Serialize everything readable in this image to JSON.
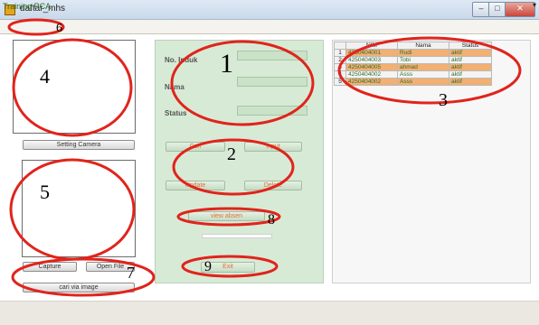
{
  "window": {
    "title": "daftar_mhs",
    "min_glyph": "–",
    "max_glyph": "□",
    "close_glyph": "✕"
  },
  "menu": {
    "training_label": "Training PCA",
    "arrow": "▾"
  },
  "left_panel": {
    "setting_camera_label": "Setting Camera",
    "capture_label": "Capture",
    "open_file_label": "Open File",
    "cari_via_image_label": "cari via image"
  },
  "form": {
    "nik_label": "No. Induk",
    "nama_label": "Nama",
    "status_label": "Status",
    "cari_label": "Cari",
    "input_label": "Input",
    "update_label": "Update",
    "delete_label": "Delete",
    "view_absen_label": "view absen",
    "exit_label": "Exit"
  },
  "table": {
    "columns": [
      "",
      "NIM",
      "Nama",
      "Status"
    ],
    "rows": [
      {
        "idx": "1",
        "nim": "4250404001",
        "nama": "Rudi",
        "status": "aktif"
      },
      {
        "idx": "2",
        "nim": "4250404003",
        "nama": "Tobi",
        "status": "aktif"
      },
      {
        "idx": "3",
        "nim": "4250404005",
        "nama": "ahmad",
        "status": "aktif"
      },
      {
        "idx": "4",
        "nim": "4250404002",
        "nama": "Asss",
        "status": "aktif"
      },
      {
        "idx": "5",
        "nim": "4250404002",
        "nama": "Asss",
        "status": "aktif"
      }
    ]
  },
  "annotations": [
    "1",
    "2",
    "3",
    "4",
    "5",
    "6",
    "7",
    "8",
    "9"
  ],
  "colors": {
    "panel_green": "#d7ead6",
    "row_orange": "#f2b073",
    "annotation_red": "#e0241c"
  }
}
